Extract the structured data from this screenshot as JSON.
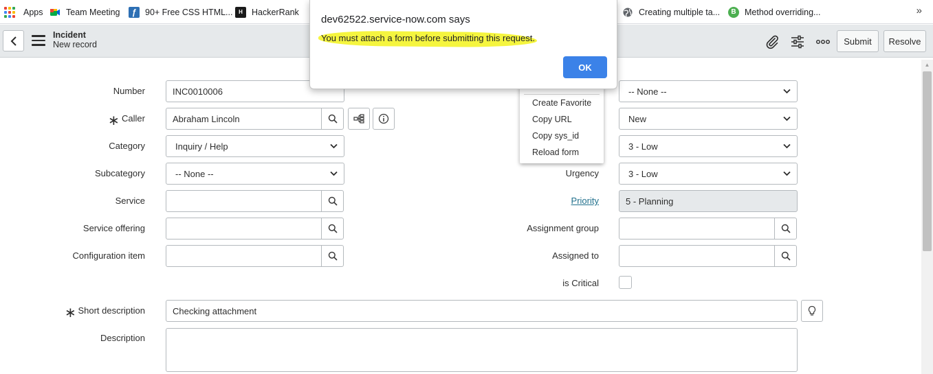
{
  "bookmarks": {
    "items": [
      {
        "label": "Apps",
        "icon": "apps-grid-icon"
      },
      {
        "label": "Team Meeting",
        "icon": "google-meet-icon"
      },
      {
        "label": "90+ Free CSS HTML...",
        "icon": "f-logo-icon"
      },
      {
        "label": "HackerRank",
        "icon": "hackerrank-icon"
      },
      {
        "label": "Creating multiple ta...",
        "icon": "globe-icon"
      },
      {
        "label": "Method overriding...",
        "icon": "b-logo-icon"
      }
    ],
    "more": "»"
  },
  "header": {
    "title": "Incident",
    "subtitle": "New record",
    "submit_label": "Submit",
    "resolve_label": "Resolve"
  },
  "form": {
    "left": {
      "number": {
        "label": "Number",
        "value": "INC0010006"
      },
      "caller": {
        "label": "Caller",
        "value": "Abraham Lincoln",
        "required_mark": "∗"
      },
      "category": {
        "label": "Category",
        "value": "Inquiry / Help"
      },
      "subcategory": {
        "label": "Subcategory",
        "value": "-- None --"
      },
      "service": {
        "label": "Service",
        "value": ""
      },
      "service_offering": {
        "label": "Service offering",
        "value": ""
      },
      "configuration_item": {
        "label": "Configuration item",
        "value": ""
      }
    },
    "right": {
      "channel_value": "-- None --",
      "state_value": "New",
      "impact_value": "3 - Low",
      "urgency": {
        "label": "Urgency",
        "value": "3 - Low"
      },
      "priority": {
        "label": "Priority",
        "value": "5 - Planning"
      },
      "assignment_group": {
        "label": "Assignment group",
        "value": ""
      },
      "assigned_to": {
        "label": "Assigned to",
        "value": ""
      },
      "is_critical": {
        "label": "is Critical"
      }
    },
    "short_description": {
      "label": "Short description",
      "value": "Checking attachment",
      "required_mark": "∗"
    },
    "description": {
      "label": "Description",
      "value": ""
    }
  },
  "context_menu": {
    "items": [
      "Create Favorite",
      "Copy URL",
      "Copy sys_id",
      "Reload form"
    ]
  },
  "dialog": {
    "title": "dev62522.service-now.com says",
    "message": "You must attach a form before submitting this request.",
    "ok_label": "OK"
  },
  "colors": {
    "header_bg": "#e6e9eb",
    "ok_button": "#3b82e8",
    "highlight": "#f5f53f",
    "priority_link": "#1f6f8b"
  }
}
